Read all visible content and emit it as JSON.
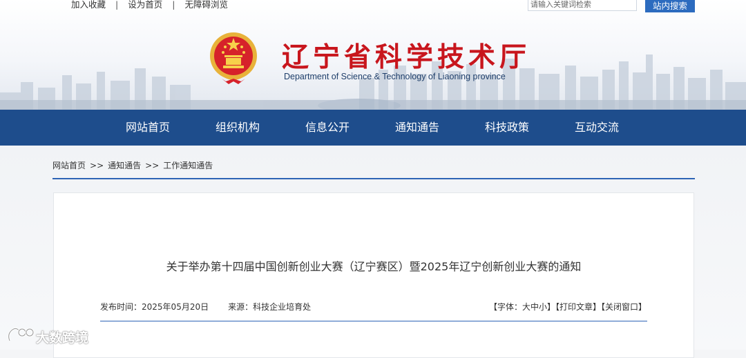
{
  "top_links": [
    "加入收藏",
    "设为首页",
    "无障碍浏览"
  ],
  "top_separator": "|",
  "search": {
    "placeholder": "请输入关键词检索",
    "button_label": "站内搜索"
  },
  "site": {
    "title": "辽宁省科学技术厅",
    "subtitle": "Department of Science & Technology of Liaoning province"
  },
  "nav": [
    "网站首页",
    "组织机构",
    "信息公开",
    "通知通告",
    "科技政策",
    "互动交流"
  ],
  "breadcrumb": [
    "网站首页",
    "通知通告",
    "工作通知通告"
  ],
  "breadcrumb_separator": ">>",
  "article": {
    "title": "关于举办第十四届中国创新创业大赛（辽宁赛区）暨2025年辽宁创新创业大赛的通知",
    "publish_label": "发布时间：",
    "publish_date": "2025年05月20日",
    "source_label": "来源：",
    "source": "科技企业培育处",
    "tools": [
      "【字体：大中小】",
      "【打印文章】",
      "【关闭窗口】"
    ]
  },
  "watermark": {
    "text": "大数跨境"
  },
  "colors": {
    "nav_bg": "#1e4d8c",
    "title_red": "#c8161d",
    "accent_blue": "#2d63b5",
    "search_button": "#2c6bbf"
  }
}
